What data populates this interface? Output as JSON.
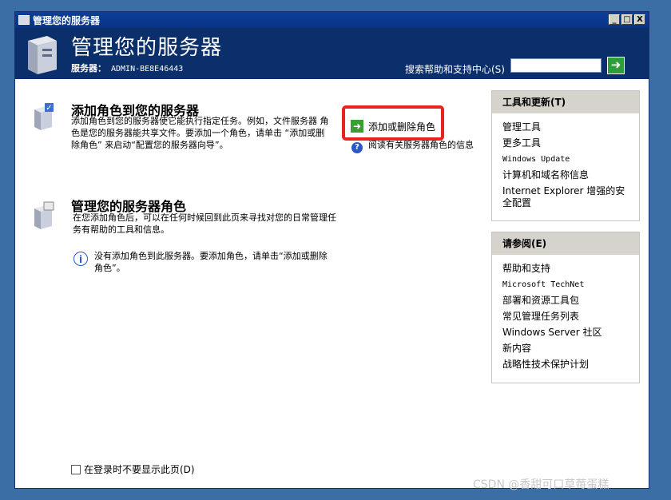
{
  "window": {
    "title": "管理您的服务器",
    "controls": [
      "_",
      "□",
      "X"
    ]
  },
  "header": {
    "title": "管理您的服务器",
    "server_label": "服务器：",
    "server_name": "ADMIN-BE8E46443",
    "search_label": "搜索帮助和支持中心(S)",
    "search_value": "",
    "go_symbol": "➜"
  },
  "add_role": {
    "title": "添加角色到您的服务器",
    "text": "添加角色到您的服务器使它能执行指定任务。例如，文件服务器 角色是您的服务器能共享文件。要添加一个角色，请单击 “添加或删除角色” 来启动“配置您的服务器向导”。",
    "link_add_remove": "添加或删除角色",
    "link_read": "阅读有关服务器角色的信息"
  },
  "manage_roles": {
    "title": "管理您的服务器角色",
    "text": "在您添加角色后，可以在任何时候回到此页来寻找对您的日常管理任务有帮助的工具和信息。",
    "info": "没有添加角色到此服务器。要添加角色，请单击“添加或删除角色”。"
  },
  "tools_panel": {
    "title": "工具和更新(T)",
    "items": [
      "管理工具",
      "更多工具",
      "Windows Update",
      "计算机和域名称信息",
      "Internet Explorer 增强的安全配置"
    ]
  },
  "see_also_panel": {
    "title": "请参阅(E)",
    "items": [
      "帮助和支持",
      "Microsoft TechNet",
      "部署和资源工具包",
      "常见管理任务列表",
      "Windows Server 社区",
      "新内容",
      "战略性技术保护计划"
    ]
  },
  "footer": {
    "checkbox_label": "在登录时不要显示此页(D)"
  },
  "watermark": "CSDN @香甜可口草莓蛋糕",
  "colors": {
    "header_bg": "#0b2f6b",
    "highlight": "#e8231f",
    "arrow_green": "#3a9e34"
  }
}
